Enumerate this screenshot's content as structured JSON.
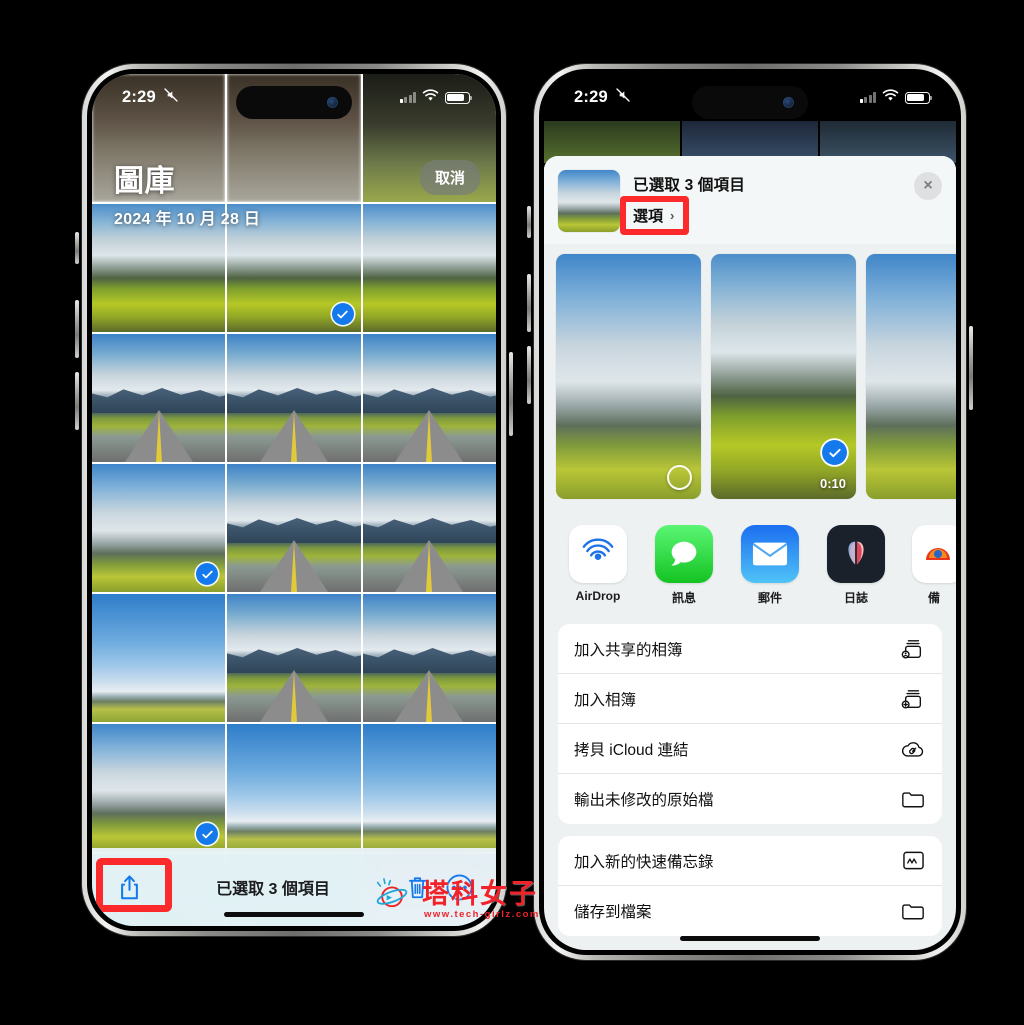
{
  "left_phone": {
    "status_bar": {
      "time": "2:29",
      "icons": [
        "silent-mode-icon",
        "cellular-signal-icon",
        "wifi-icon",
        "battery-icon"
      ]
    },
    "header": {
      "title": "圖庫",
      "date": "2024 年 10 月 28 日",
      "cancel_label": "取消"
    },
    "grid": {
      "selected_count": 3,
      "rows": [
        [
          {
            "scene": "blur-top",
            "selected": false
          },
          {
            "scene": "blur-top",
            "selected": false
          },
          {
            "scene": "dark-top",
            "selected": false
          }
        ],
        [
          {
            "scene": "rice",
            "selected": false
          },
          {
            "scene": "rice",
            "selected": true
          },
          {
            "scene": "rice",
            "selected": false
          }
        ],
        [
          {
            "scene": "road",
            "selected": false
          },
          {
            "scene": "road",
            "selected": false
          },
          {
            "scene": "road",
            "selected": false
          }
        ],
        [
          {
            "scene": "sky-cloudy",
            "selected": true
          },
          {
            "scene": "road",
            "selected": false
          },
          {
            "scene": "road",
            "selected": false
          }
        ],
        [
          {
            "scene": "sky-blue",
            "selected": false
          },
          {
            "scene": "road",
            "selected": false
          },
          {
            "scene": "road",
            "selected": false
          }
        ],
        [
          {
            "scene": "sky-cloudy",
            "selected": true
          },
          {
            "scene": "sky-blue",
            "selected": false
          },
          {
            "scene": "sky-blue",
            "selected": false
          }
        ],
        [
          {
            "scene": "water",
            "selected": false
          },
          {
            "scene": "water",
            "selected": false
          },
          {
            "scene": "sky-blue",
            "selected": false
          }
        ]
      ]
    },
    "toolbar": {
      "share_label": "share-icon",
      "count_text": "已選取 3 個項目",
      "trash_label": "trash-icon",
      "more_label": "more-ellipsis-icon",
      "highlight_color": "#fc2a2a"
    }
  },
  "right_phone": {
    "status_bar": {
      "time": "2:29",
      "icons": [
        "silent-mode-icon",
        "cellular-signal-icon",
        "wifi-icon",
        "battery-icon"
      ]
    },
    "share_sheet": {
      "title": "已選取 3 個項目",
      "options_label": "選項",
      "options_chevron": "›",
      "close_label": "×",
      "highlight_color": "#fc2a2a",
      "strip": [
        {
          "scene": "sky-cloudy",
          "selected": false,
          "duration": ""
        },
        {
          "scene": "rice",
          "selected": true,
          "duration": "0:10"
        },
        {
          "scene": "sky-cloudy",
          "selected": false,
          "duration": ""
        }
      ],
      "apps": [
        {
          "label": "AirDrop",
          "icon": "airdrop-icon",
          "color": "#ffffff"
        },
        {
          "label": "訊息",
          "icon": "messages-icon",
          "color": "#2ecc41"
        },
        {
          "label": "郵件",
          "icon": "mail-icon",
          "color": "#1f8ef1"
        },
        {
          "label": "日誌",
          "icon": "journal-icon",
          "color": "#1b212b"
        },
        {
          "label": "備",
          "icon": "app-partial-icon",
          "color": "#ffffff"
        }
      ],
      "actions_group_1": [
        {
          "label": "加入共享的相簿",
          "icon": "shared-album-icon"
        },
        {
          "label": "加入相簿",
          "icon": "add-album-icon"
        },
        {
          "label": "拷貝 iCloud 連結",
          "icon": "icloud-link-icon"
        },
        {
          "label": "輸出未修改的原始檔",
          "icon": "folder-icon"
        }
      ],
      "actions_group_2": [
        {
          "label": "加入新的快速備忘錄",
          "icon": "quick-note-icon"
        },
        {
          "label": "儲存到檔案",
          "icon": "folder-icon"
        }
      ]
    }
  },
  "watermark": {
    "main": "塔科女子",
    "sub": "www.tech-girlz.com"
  },
  "theme": {
    "accent_blue": "#1479ec",
    "highlight_red": "#fc2a2a",
    "sheet_bg": "#edf1f2"
  }
}
